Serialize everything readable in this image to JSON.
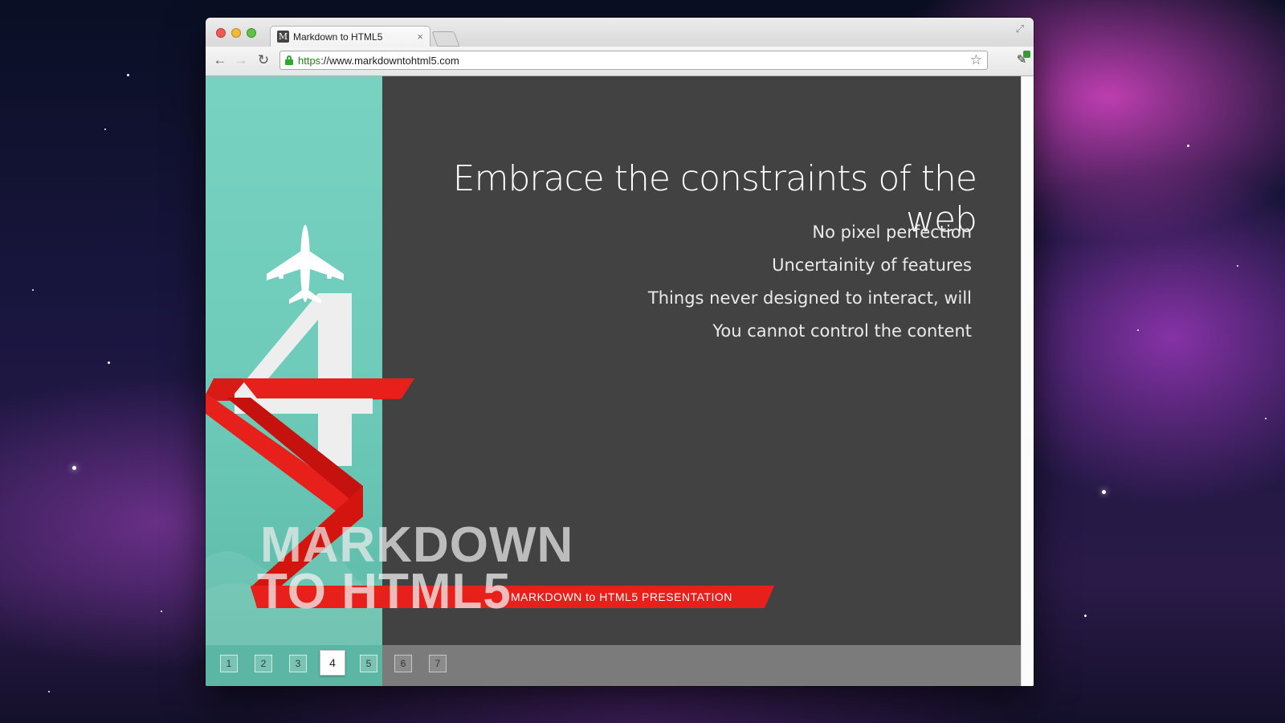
{
  "browser": {
    "tab_title": "Markdown to HTML5",
    "tab_favicon_letter": "M",
    "tab_close": "×",
    "url_scheme": "https",
    "url_rest": "://www.markdowntohtml5.com",
    "icons": {
      "back": "back-arrow-icon",
      "forward": "forward-arrow-icon",
      "reload": "reload-icon",
      "bookmark": "star-icon",
      "extension": "extension-icon",
      "fullscreen": "fullscreen-icon",
      "lock": "lock-icon"
    }
  },
  "slide": {
    "title": "Embrace the constraints of the web",
    "bullets": [
      "No pixel perfection",
      "Uncertainity of features",
      "Things never designed to interact, will",
      "You cannot control the content"
    ]
  },
  "branding": {
    "number": "4",
    "line1": "MARKDOWN",
    "line2": "TO HTML5",
    "banner": "MARKDOWN to HTML5 PRESENTATION"
  },
  "pager": {
    "pages": [
      "1",
      "2",
      "3",
      "4",
      "5",
      "6",
      "7"
    ],
    "current": "4"
  },
  "colors": {
    "teal": "#6ecbb9",
    "slide_bg": "#424242",
    "ribbon_red": "#e8201c",
    "footer_grey": "#7b7b7b"
  }
}
